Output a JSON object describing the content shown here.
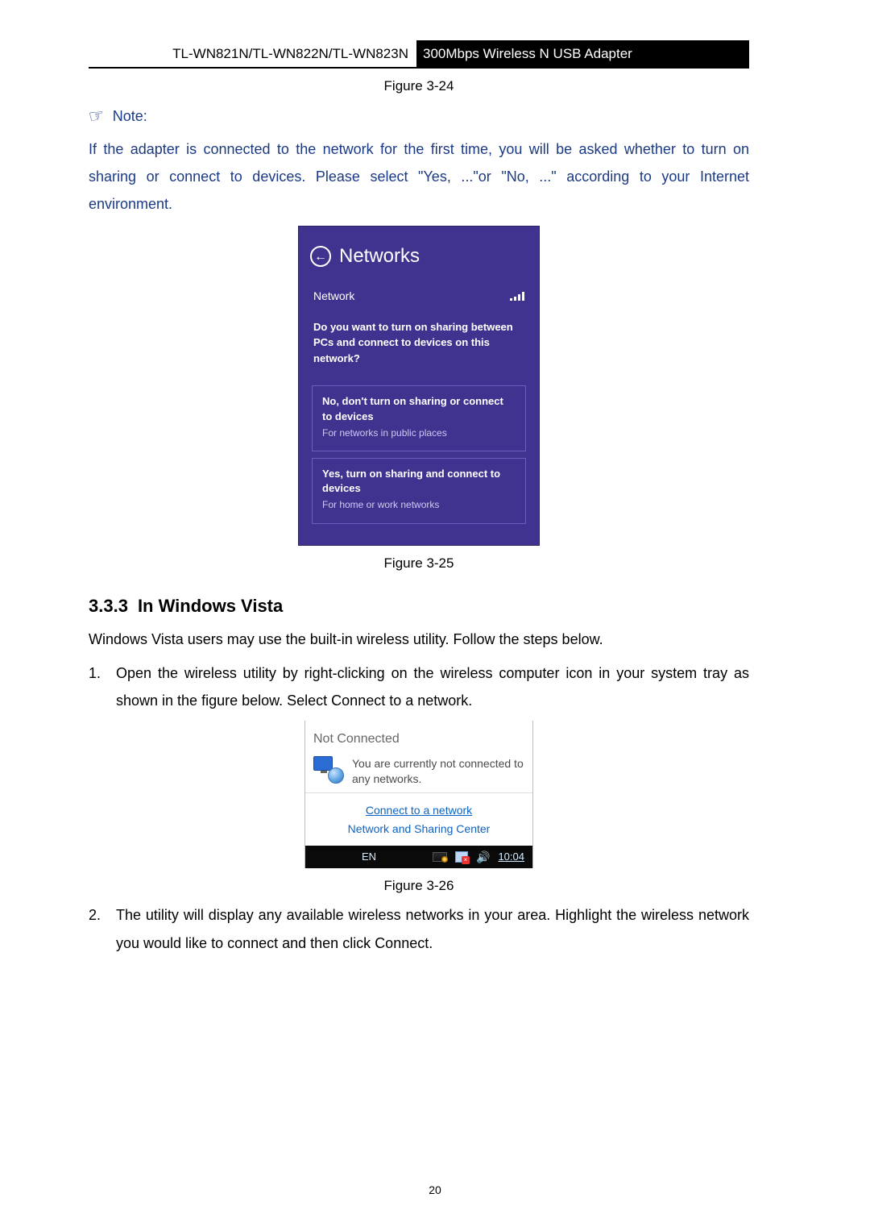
{
  "header": {
    "models": "TL-WN821N/TL-WN822N/TL-WN823N",
    "product": "300Mbps Wireless N USB Adapter"
  },
  "figures": {
    "fig24": "Figure 3-24",
    "fig25": "Figure 3-25",
    "fig26": "Figure 3-26"
  },
  "note": {
    "label": "Note:",
    "text": "If the adapter is connected to the network for the first time, you will be asked whether to turn on sharing or connect to devices. Please select \"Yes, ...\"or \"No, ...\" according to your Internet environment."
  },
  "networks_panel": {
    "title": "Networks",
    "row_label": "Network",
    "question": "Do you want to turn on sharing between PCs and connect to devices on this network?",
    "option_no_title": "No, don't turn on sharing or connect to devices",
    "option_no_sub": "For networks in public places",
    "option_yes_title": "Yes, turn on sharing and connect to devices",
    "option_yes_sub": "For home or work networks"
  },
  "section": {
    "number": "3.3.3",
    "title": "In Windows Vista",
    "intro": "Windows Vista users may use the built-in wireless utility. Follow the steps below.",
    "step1_prefix": "Open the wireless utility by right-clicking on the wireless computer icon in your system tray as shown in the figure below. Select ",
    "step1_emph": "Connect to a network",
    "step1_suffix": ".",
    "step2_prefix": "The utility will display any available wireless networks in your area. Highlight the wireless network you would like to connect and then click ",
    "step2_emph": "Connect",
    "step2_suffix": "."
  },
  "vista_popup": {
    "title": "Not Connected",
    "message": "You are currently not connected to any networks.",
    "link_connect": "Connect to a network",
    "link_center": "Network and Sharing Center",
    "lang": "EN",
    "clock": "10:04"
  },
  "page_number": "20"
}
